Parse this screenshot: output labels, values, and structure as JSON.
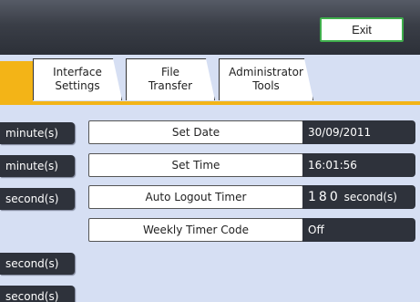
{
  "header": {
    "exit_label": "Exit"
  },
  "tabs": [
    {
      "line1": "Interface",
      "line2": "Settings"
    },
    {
      "line1": "File",
      "line2": "Transfer"
    },
    {
      "line1": "Administrator",
      "line2": "Tools"
    }
  ],
  "side_units": [
    "minute(s)",
    "minute(s)",
    "second(s)",
    "second(s)",
    "second(s)"
  ],
  "rows": [
    {
      "label": "Set Date",
      "value": "30/09/2011"
    },
    {
      "label": "Set Time",
      "value": "16:01:56"
    },
    {
      "label": "Auto Logout Timer",
      "value_number": "180",
      "value_unit": "second(s)"
    },
    {
      "label": "Weekly Timer Code",
      "value": "Off"
    }
  ]
}
